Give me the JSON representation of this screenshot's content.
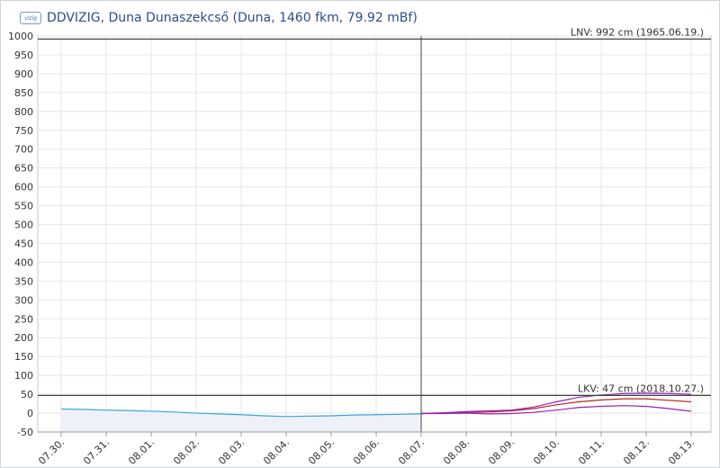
{
  "header": {
    "logo_text": "vizig",
    "title": "DDVIZIG, Duna Dunaszekcső (Duna, 1460 fkm, 79.92 mBf)"
  },
  "colors": {
    "grid": "#e6e6e6",
    "measured": "#3aa6d8",
    "measured_fill": "#eef2f8",
    "forecast_mid": "#b5281e",
    "forecast_low": "#9a1fb8",
    "forecast_high": "#9a1fb8",
    "refline": "#444444"
  },
  "chart_data": {
    "type": "line",
    "ylim": [
      -50,
      1000
    ],
    "yticks": [
      -50,
      0,
      50,
      100,
      150,
      200,
      250,
      300,
      350,
      400,
      450,
      500,
      550,
      600,
      650,
      700,
      750,
      800,
      850,
      900,
      950,
      1000
    ],
    "xlim": [
      0,
      14.4
    ],
    "x_tick_labels": [
      "07.30.",
      "07.31.",
      "08.01.",
      "08.02.",
      "08.03.",
      "08.04.",
      "08.05.",
      "08.06.",
      "08.07.",
      "08.08.",
      "08.09.",
      "08.10.",
      "08.11.",
      "08.12.",
      "08.13."
    ],
    "now_marker_x": 8.0,
    "reference_lines": [
      {
        "value": 992,
        "label": "LNV: 992 cm (1965.06.19.)"
      },
      {
        "value": 47,
        "label": "LKV: 47 cm (2018.10.27.)"
      }
    ],
    "series": [
      {
        "role": "measured",
        "x": [
          0,
          0.5,
          1,
          1.5,
          2,
          2.5,
          3,
          3.5,
          4,
          4.5,
          5,
          5.5,
          6,
          6.5,
          7,
          7.5,
          8
        ],
        "y": [
          11,
          10,
          8,
          7,
          5,
          3,
          0,
          -2,
          -4,
          -7,
          -9,
          -8,
          -7,
          -5,
          -4,
          -3,
          -2
        ]
      },
      {
        "role": "forecast_mid",
        "x": [
          8,
          8.5,
          9,
          9.5,
          10,
          10.5,
          11,
          11.5,
          12,
          12.5,
          13,
          13.5,
          14
        ],
        "y": [
          -1,
          0,
          2,
          3,
          6,
          12,
          22,
          30,
          35,
          38,
          38,
          34,
          30
        ]
      },
      {
        "role": "forecast_low",
        "x": [
          8,
          8.5,
          9,
          9.5,
          10,
          10.5,
          11,
          11.5,
          12,
          12.5,
          13,
          13.5,
          14
        ],
        "y": [
          -1,
          -1,
          0,
          -2,
          -1,
          2,
          8,
          15,
          18,
          20,
          18,
          12,
          5
        ]
      },
      {
        "role": "forecast_high",
        "x": [
          8,
          8.5,
          9,
          9.5,
          10,
          10.5,
          11,
          11.5,
          12,
          12.5,
          13,
          13.5,
          14
        ],
        "y": [
          -1,
          1,
          4,
          6,
          8,
          16,
          30,
          42,
          48,
          52,
          53,
          52,
          50
        ]
      }
    ]
  }
}
